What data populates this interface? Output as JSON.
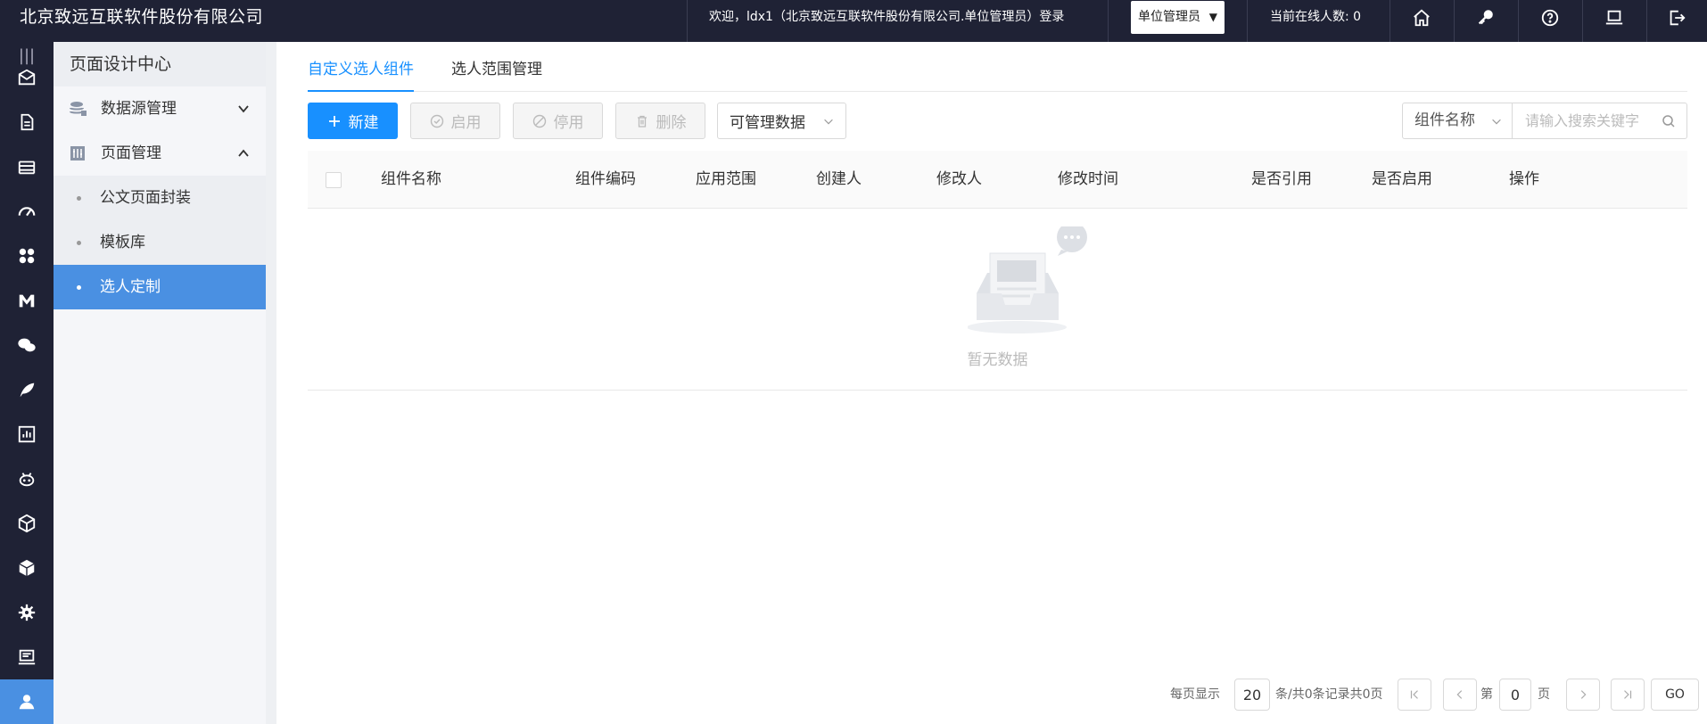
{
  "header": {
    "brand": "北京致远互联软件股份有限公司",
    "welcome": "欢迎，ldx1（北京致远互联软件股份有限公司.单位管理员）登录",
    "role_selected": "单位管理员",
    "online_count": "当前在线人数: 0",
    "icons": [
      "home-icon",
      "key-icon",
      "help-icon",
      "monitor-icon",
      "logout-icon"
    ]
  },
  "rail": {
    "icons": [
      "envelope-icon",
      "document-icon",
      "database-icon",
      "dashboard-icon",
      "apps-icon",
      "m-logo-icon",
      "chat-icon",
      "feather-icon",
      "chart-icon",
      "robot-icon",
      "cube-network-icon",
      "cube-icon",
      "settings-icon",
      "laptop-icon",
      "user-icon"
    ],
    "active": "user-icon"
  },
  "sidebar": {
    "title": "页面设计中心",
    "groups": [
      {
        "label": "数据源管理",
        "expanded": false
      },
      {
        "label": "页面管理",
        "expanded": true
      }
    ],
    "sub_items": [
      {
        "label": "公文页面封装",
        "active": false
      },
      {
        "label": "模板库",
        "active": false
      },
      {
        "label": "选人定制",
        "active": true
      }
    ]
  },
  "main": {
    "tabs": [
      {
        "label": "自定义选人组件",
        "active": true
      },
      {
        "label": "选人范围管理",
        "active": false
      }
    ],
    "toolbar": {
      "new_label": "新建",
      "enable_label": "启用",
      "disable_label": "停用",
      "delete_label": "删除",
      "filter_label": "可管理数据",
      "search_category": "组件名称",
      "search_placeholder": "请输入搜索关键字"
    },
    "table": {
      "columns": [
        "组件名称",
        "组件编码",
        "应用范围",
        "创建人",
        "修改人",
        "修改时间",
        "是否引用",
        "是否启用",
        "操作"
      ],
      "rows": [],
      "empty_text": "暂无数据"
    },
    "pagination": {
      "per_page_label": "每页显示",
      "per_page": "20",
      "summary": "条/共0条记录共0页",
      "page_prefix": "第",
      "page": "0",
      "page_suffix": "页",
      "go_label": "GO"
    }
  },
  "colors": {
    "primary": "#1890ff",
    "dark_bg": "#1f2235",
    "active_nav": "#4a90e2"
  }
}
